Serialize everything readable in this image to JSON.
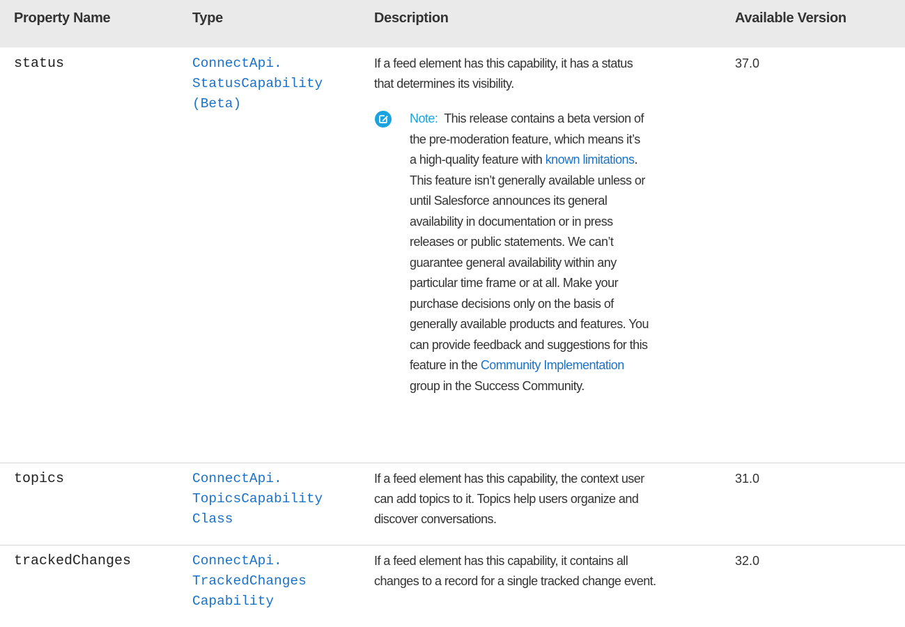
{
  "table": {
    "headers": {
      "property_name": "Property Name",
      "type": "Type",
      "description": "Description",
      "available_version": "Available Version"
    },
    "rows": [
      {
        "property": "status",
        "type_lines": [
          "ConnectApi.",
          "StatusCapability",
          "(Beta)"
        ],
        "description_lines": [
          "If a feed element has this capability, it has a status",
          "that determines its visibility."
        ],
        "note": {
          "label": "Note:",
          "link_known_limitations": "known limitations",
          "link_community": "Community Implementation",
          "lines": [
            "This release contains a beta version of",
            "the pre-moderation feature, which means it’s",
            "a high-quality feature with",
            "This feature isn’t generally available unless or",
            "until Salesforce announces its general",
            "availability in documentation or in press",
            "releases or public statements. We can’t",
            "guarantee general availability within any",
            "particular time frame or at all. Make your",
            "purchase decisions only on the basis of",
            "generally available products and features. You",
            "can provide feedback and suggestions for this",
            "feature in the",
            "group in the Success Community."
          ]
        },
        "version": "37.0",
        "icon": "edit-note-icon"
      },
      {
        "property": "topics",
        "type_lines": [
          "ConnectApi.",
          "TopicsCapability",
          "Class"
        ],
        "description_lines": [
          "If a feed element has this capability, the context user",
          "can add topics to it. Topics help users organize and",
          "discover conversations."
        ],
        "version": "31.0"
      },
      {
        "property": "trackedChanges",
        "type_lines": [
          "ConnectApi.",
          "TrackedChanges",
          "Capability"
        ],
        "description_lines": [
          "If a feed element has this capability, it contains all",
          "changes to a record for a single tracked change event."
        ],
        "version": "32.0"
      }
    ]
  },
  "colors": {
    "header_bg": "#eaeaea",
    "link": "#1b73c9",
    "note_accent": "#1ba3e0",
    "text": "#333333",
    "divider": "#d6d6d6"
  }
}
